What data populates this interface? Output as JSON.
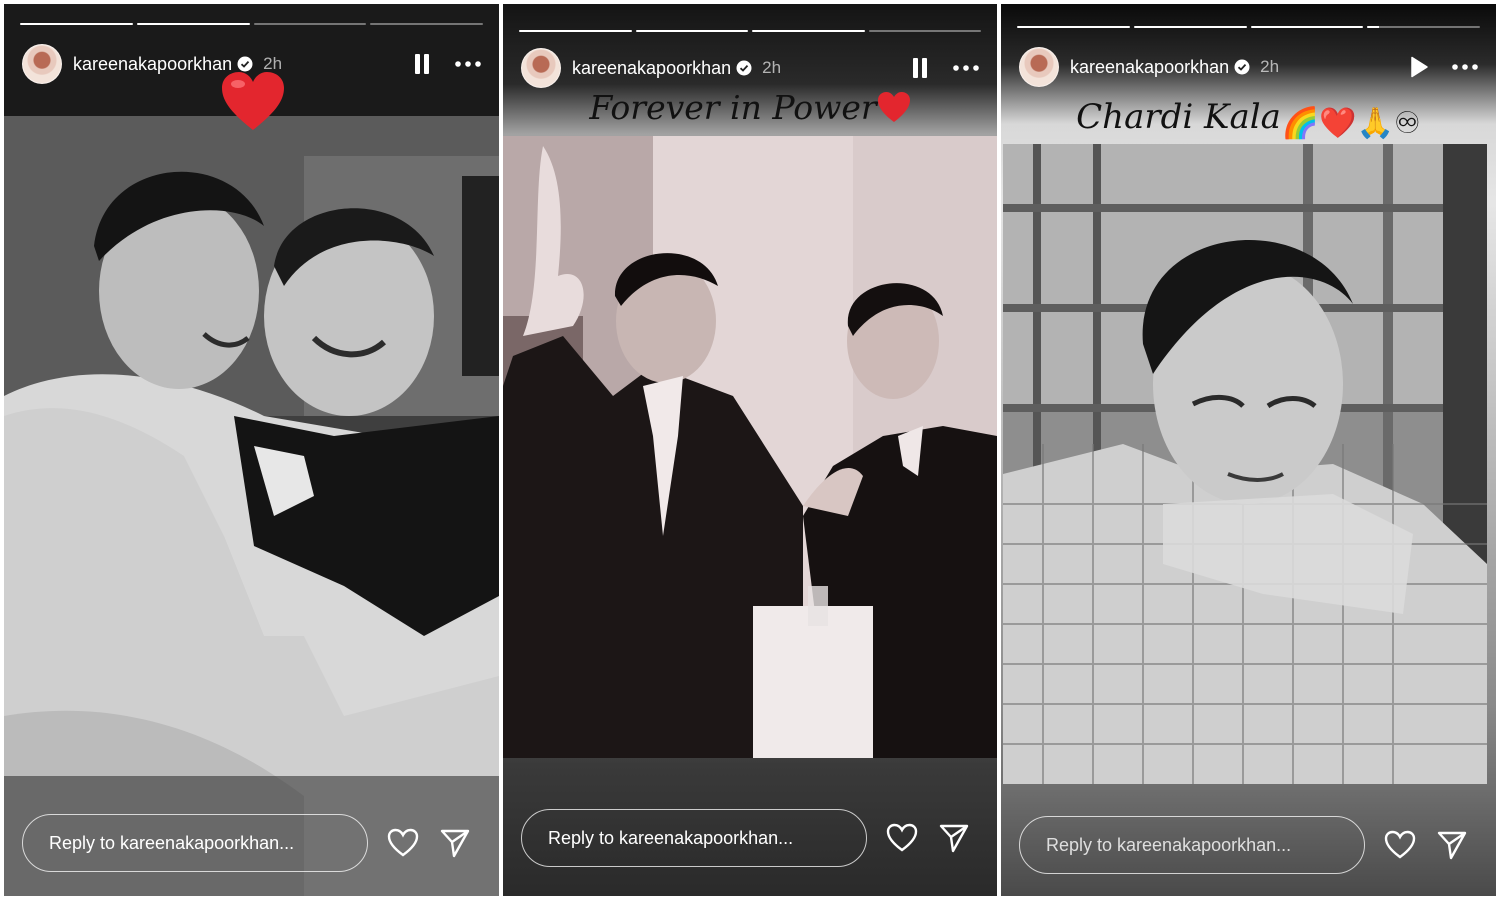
{
  "colors": {
    "text": "#ffffff",
    "heart": "#e3262e",
    "verified": "#ffffff"
  },
  "stories": [
    {
      "username": "kareenakapoorkhan",
      "timestamp": "2h",
      "playback_state": "pause-icon",
      "progress": [
        1,
        1,
        0,
        0
      ],
      "caption": "",
      "sticker": "heart",
      "reply_placeholder": "Reply to kareenakapoorkhan..."
    },
    {
      "username": "kareenakapoorkhan",
      "timestamp": "2h",
      "playback_state": "pause-icon",
      "progress": [
        1,
        1,
        1,
        0
      ],
      "caption": "Forever in Power",
      "caption_emoji": "❤️",
      "reply_placeholder": "Reply to kareenakapoorkhan..."
    },
    {
      "username": "kareenakapoorkhan",
      "timestamp": "2h",
      "playback_state": "play-icon",
      "progress": [
        1,
        1,
        1,
        0.1
      ],
      "caption": "Chardi Kala",
      "caption_emoji": "🌈❤️🙏♾",
      "reply_placeholder": "Reply to kareenakapoorkhan..."
    }
  ]
}
